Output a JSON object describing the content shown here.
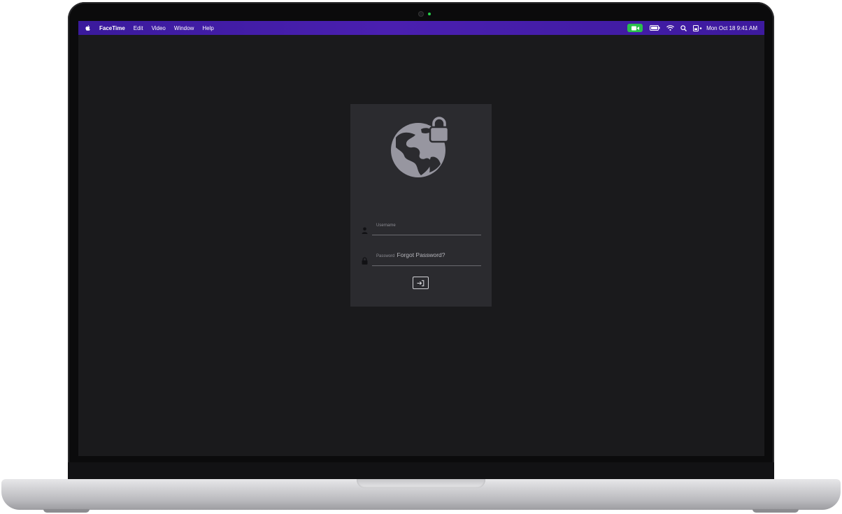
{
  "menubar": {
    "app_name": "FaceTime",
    "items": [
      "Edit",
      "Video",
      "Window",
      "Help"
    ],
    "clock": "Mon Oct 18  9:41 AM",
    "accent": "#4a1fb0"
  },
  "login": {
    "username_placeholder": "Username",
    "password_placeholder": "Password",
    "forgot_label": "Forgot Password?",
    "hero_icon": "globe-lock-icon",
    "submit_icon": "login-arrow-icon"
  },
  "colors": {
    "screen_bg": "#1a1a1c",
    "card_bg": "#2b2b2f",
    "icon_gray": "#9796a0",
    "facetime_green": "#2ac04c"
  }
}
